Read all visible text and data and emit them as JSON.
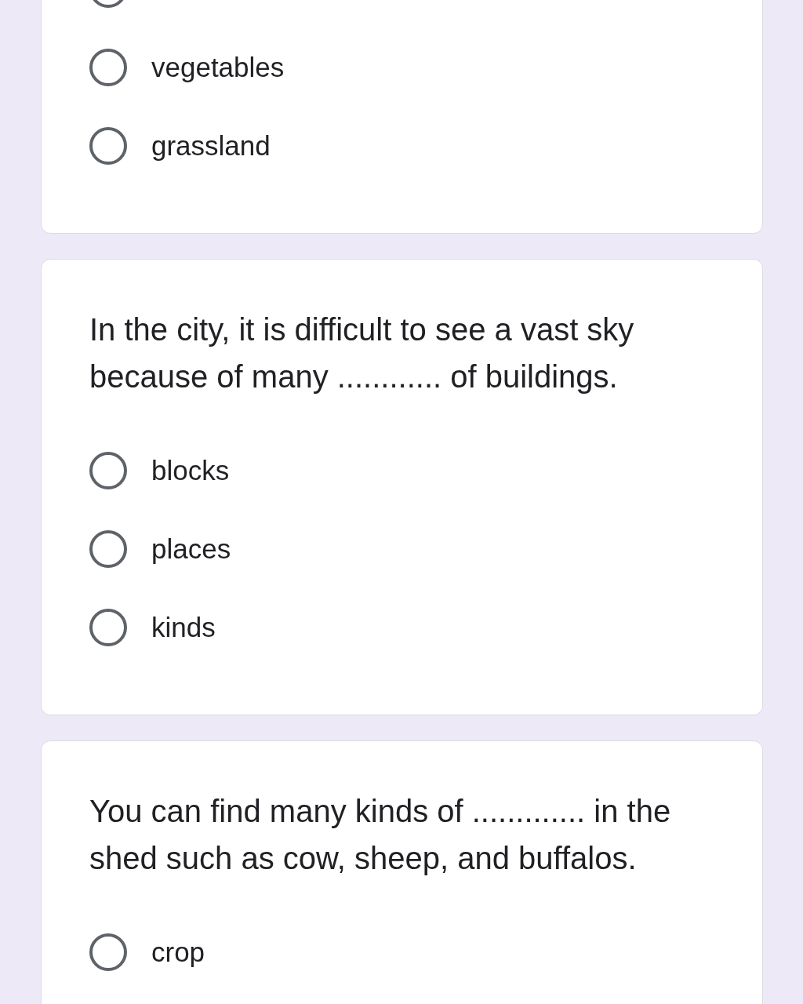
{
  "questions": [
    {
      "options": [
        {
          "selected": false
        },
        {
          "label": "vegetables",
          "selected": false
        },
        {
          "label": "grassland",
          "selected": false
        }
      ]
    },
    {
      "text": "In the city, it is difficult to see a vast sky because of many ............ of buildings.",
      "options": [
        {
          "label": "blocks",
          "selected": false
        },
        {
          "label": "places",
          "selected": false
        },
        {
          "label": "kinds",
          "selected": false
        }
      ]
    },
    {
      "text": "You can find many kinds of ............. in the shed such as cow, sheep, and buffalos.",
      "options": [
        {
          "label": "crop",
          "selected": false
        }
      ]
    }
  ]
}
